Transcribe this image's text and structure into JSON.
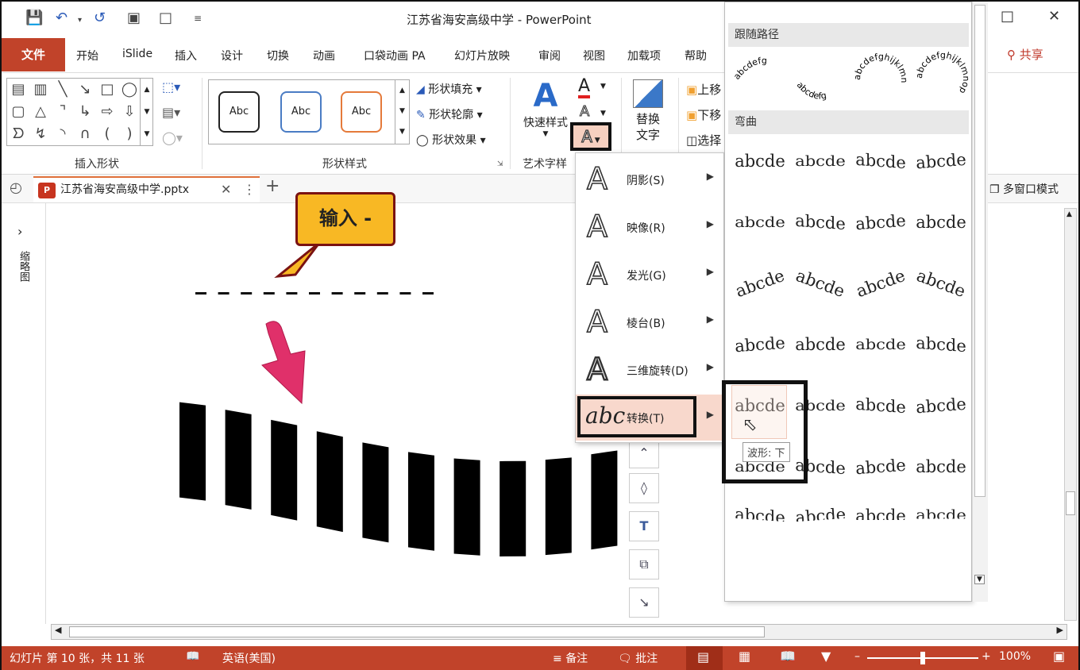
{
  "window": {
    "title": "江苏省海安高级中学 - PowerPoint",
    "quick_access": [
      "save-icon",
      "undo-icon",
      "redo-icon",
      "present-icon",
      "new-file-icon",
      "customize-icon"
    ],
    "share_label": "共享"
  },
  "menubar": {
    "file": "文件",
    "tabs": [
      "开始",
      "iSlide",
      "插入",
      "设计",
      "切换",
      "动画",
      "口袋动画 PA",
      "幻灯片放映",
      "审阅",
      "视图",
      "加载项",
      "帮助"
    ]
  },
  "ribbon": {
    "insert_shapes": {
      "label": "插入形状"
    },
    "shape_styles": {
      "label": "形状样式",
      "samples": [
        "Abc",
        "Abc",
        "Abc"
      ],
      "fill": "形状填充",
      "outline": "形状轮廓",
      "effects": "形状效果"
    },
    "wordart": {
      "label": "艺术字样",
      "quick_styles": "快速样式"
    },
    "alt_text": {
      "label": "替换文字"
    },
    "arrange": {
      "bring_forward": "上移",
      "send_backward": "下移",
      "selection": "选择"
    }
  },
  "document_tab": {
    "name": "江苏省海安高级中学.pptx",
    "multi_window": "多窗口模式"
  },
  "left_pane": {
    "label": "缩略图"
  },
  "slide": {
    "callout_text": "输入 -",
    "dash_count": 11,
    "bar_count": 10
  },
  "text_effects_menu": {
    "items": [
      {
        "label": "阴影(S)",
        "icon": "shadow-a-icon"
      },
      {
        "label": "映像(R)",
        "icon": "reflection-a-icon"
      },
      {
        "label": "发光(G)",
        "icon": "glow-a-icon"
      },
      {
        "label": "棱台(B)",
        "icon": "bevel-a-icon"
      },
      {
        "label": "三维旋转(D)",
        "icon": "3d-rotation-a-icon"
      },
      {
        "label": "转换(T)",
        "icon": "transform-abc-icon",
        "selected": true
      }
    ]
  },
  "transform_gallery": {
    "section_follow_path": "跟随路径",
    "follow_path_samples": [
      "abcdefg",
      "abcdefg",
      "abcdefghijklmn",
      "abcdefghijklmnop"
    ],
    "section_warp": "弯曲",
    "warp_sample": "abcde",
    "warp_rows": 7,
    "warp_cols": 4,
    "tooltip": "波形: 下"
  },
  "statusbar": {
    "slide_info": "幻灯片 第 10 张，共 11 张",
    "language": "英语(美国)",
    "notes": "备注",
    "comments": "批注",
    "zoom": "100%",
    "zoom_level": 0.5
  }
}
